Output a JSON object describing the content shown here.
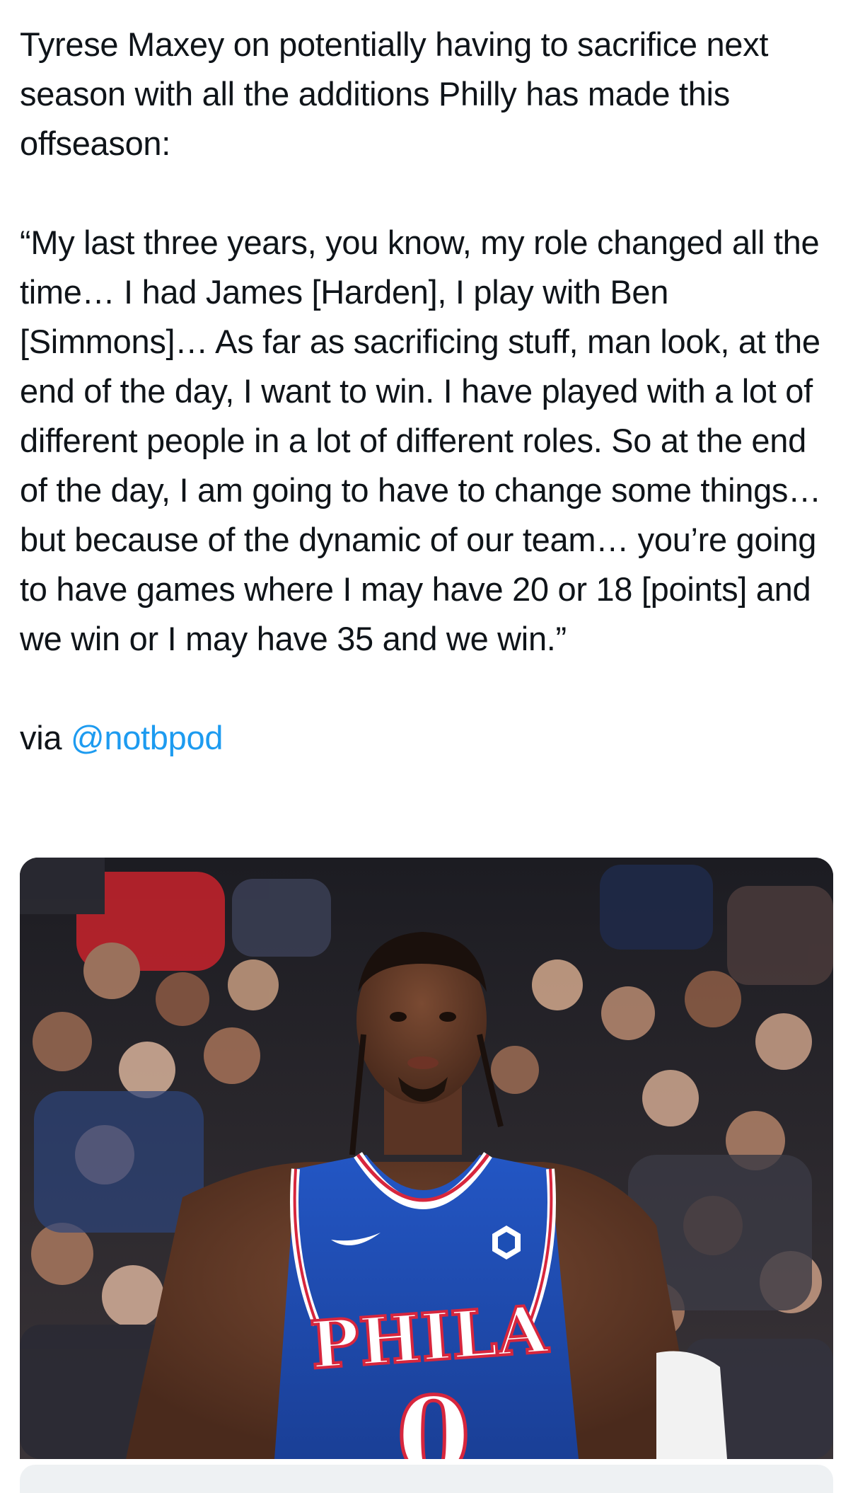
{
  "tweet": {
    "intro": "Tyrese Maxey on potentially having to sacrifice next season with all the additions Philly has made this offseason:",
    "quote": "“My last three years, you know, my role changed all the time… I had James [Harden], I play with Ben [Simmons]… As far as sacrificing stuff, man look, at the end of the day, I want to win. I have played with a lot of different people in a lot of different roles. So at the end of the day, I am going to have to change some things… but because of the dynamic of our team… you’re going to have games where I may have 20 or 18 [points] and we win or I may have 35 and we win.”",
    "via_label": "via",
    "mention": "@notbpod"
  },
  "media": {
    "jersey_text": "PHILA",
    "jersey_number": "0"
  },
  "colors": {
    "link": "#1d9bf0",
    "text": "#0f1419",
    "jersey_blue": "#1d4fb5",
    "jersey_red": "#d7263d"
  }
}
